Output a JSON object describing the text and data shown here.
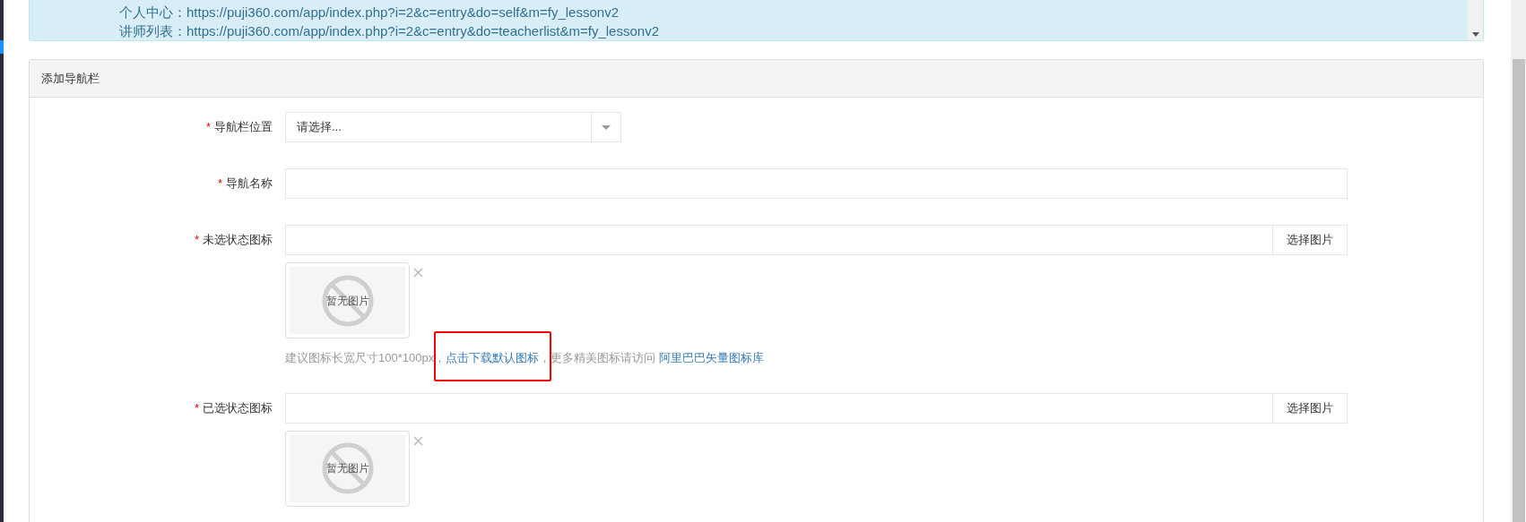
{
  "info_box": {
    "lines": [
      {
        "label": "个人中心：",
        "url": "https://puji360.com/app/index.php?i=2&c=entry&do=self&m=fy_lessonv2"
      },
      {
        "label": "讲师列表：",
        "url": "https://puji360.com/app/index.php?i=2&c=entry&do=teacherlist&m=fy_lessonv2"
      }
    ]
  },
  "panel": {
    "title": "添加导航栏",
    "fields": [
      {
        "kind": "select",
        "marker": "*",
        "label": "导航栏位置",
        "placeholder": "请选择..."
      },
      {
        "kind": "text",
        "marker": "*",
        "label": "导航名称"
      },
      {
        "kind": "image",
        "marker": "*",
        "label": "未选状态图标",
        "button": "选择图片",
        "preview_text": "暂无图片",
        "hint": [
          {
            "kind": "text",
            "text": "建议图标长宽尺寸100*100px，"
          },
          {
            "kind": "link",
            "text": "点击下载默认图标",
            "highlighted": true
          },
          {
            "kind": "text",
            "text": "，更多精美图标请访问 "
          },
          {
            "kind": "link",
            "text": "阿里巴巴矢量图标库",
            "highlighted": false
          }
        ]
      },
      {
        "kind": "image",
        "marker": "*",
        "label": "已选状态图标",
        "button": "选择图片",
        "preview_text": "暂无图片"
      }
    ]
  }
}
